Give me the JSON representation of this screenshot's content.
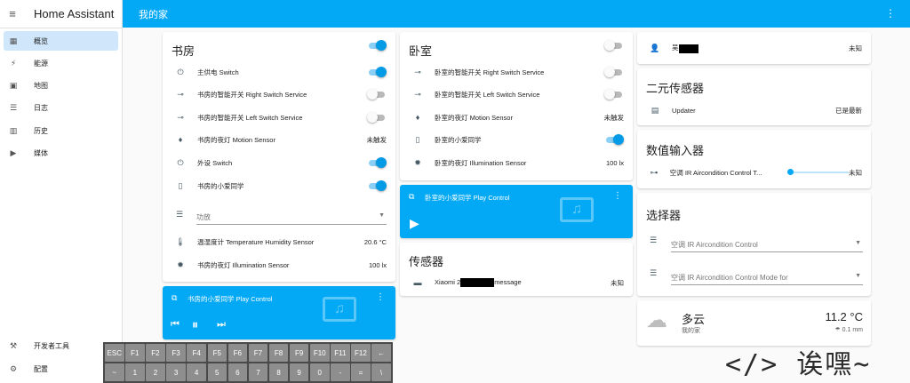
{
  "sidebar": {
    "title": "Home Assistant",
    "items": [
      {
        "label": "概览"
      },
      {
        "label": "能源"
      },
      {
        "label": "地图"
      },
      {
        "label": "日志"
      },
      {
        "label": "历史"
      },
      {
        "label": "媒体"
      }
    ],
    "bottom": [
      {
        "label": "开发者工具"
      },
      {
        "label": "配置"
      }
    ]
  },
  "topbar": {
    "title": "我的家"
  },
  "study": {
    "title": "书房",
    "rows": [
      {
        "name": "主供电 Switch"
      },
      {
        "name": "书房的智能开关 Right Switch Service"
      },
      {
        "name": "书房的智能开关 Left Switch Service"
      },
      {
        "name": "书房的夜灯 Motion Sensor",
        "value": "未触发"
      },
      {
        "name": "外设 Switch"
      },
      {
        "name": "书房的小爱同学"
      }
    ],
    "select_placeholder": "功放",
    "temp_name": "温湿度计 Temperature Humidity Sensor",
    "temp_value": "20.6 °C",
    "illum_name": "书房的夜灯 Illumination Sensor",
    "illum_value": "100 lx"
  },
  "study_media": {
    "title": "书房的小爱同学 Play Control"
  },
  "bedroom": {
    "title": "卧室",
    "rows": [
      {
        "name": "卧室的智能开关 Right Switch Service"
      },
      {
        "name": "卧室的智能开关 Left Switch Service"
      },
      {
        "name": "卧室的夜灯 Motion Sensor",
        "value": "未触发"
      },
      {
        "name": "卧室的小爱同学"
      },
      {
        "name": "卧室的夜灯 Illumination Sensor",
        "value": "100 lx"
      }
    ]
  },
  "bedroom_media": {
    "title": "卧室的小爱同学 Play Control"
  },
  "sensors": {
    "title": "传感器",
    "row_prefix": "Xiaomi 2",
    "row_suffix": "message",
    "row_value": "未知"
  },
  "person": {
    "name": "吴",
    "value": "未知"
  },
  "binary": {
    "title": "二元传感器",
    "row": "Updater",
    "value": "已是最新"
  },
  "number": {
    "title": "数值输入器",
    "row": "空调 IR Aircondition Control T...",
    "value": "未知"
  },
  "select_card": {
    "title": "选择器",
    "field1": "空调 IR Aircondition Control",
    "field2": "空调 IR Aircondition Control Mode for"
  },
  "weather": {
    "condition": "多云",
    "location": "我的家",
    "temp": "11.2 °C",
    "precip": "0.1 mm"
  },
  "keyboard": {
    "row1": [
      "ESC",
      "F1",
      "F2",
      "F3",
      "F4",
      "F5",
      "F6",
      "F7",
      "F8",
      "F9",
      "F10",
      "F11",
      "F12",
      "←"
    ],
    "row2": [
      "~",
      "1",
      "2",
      "3",
      "4",
      "5",
      "6",
      "7",
      "8",
      "9",
      "0",
      "-",
      "=",
      "\\"
    ]
  },
  "watermark": "</> 诶嘿~",
  "colors": {
    "primary": "#03a9f4",
    "toggle_on": "#039be5"
  }
}
